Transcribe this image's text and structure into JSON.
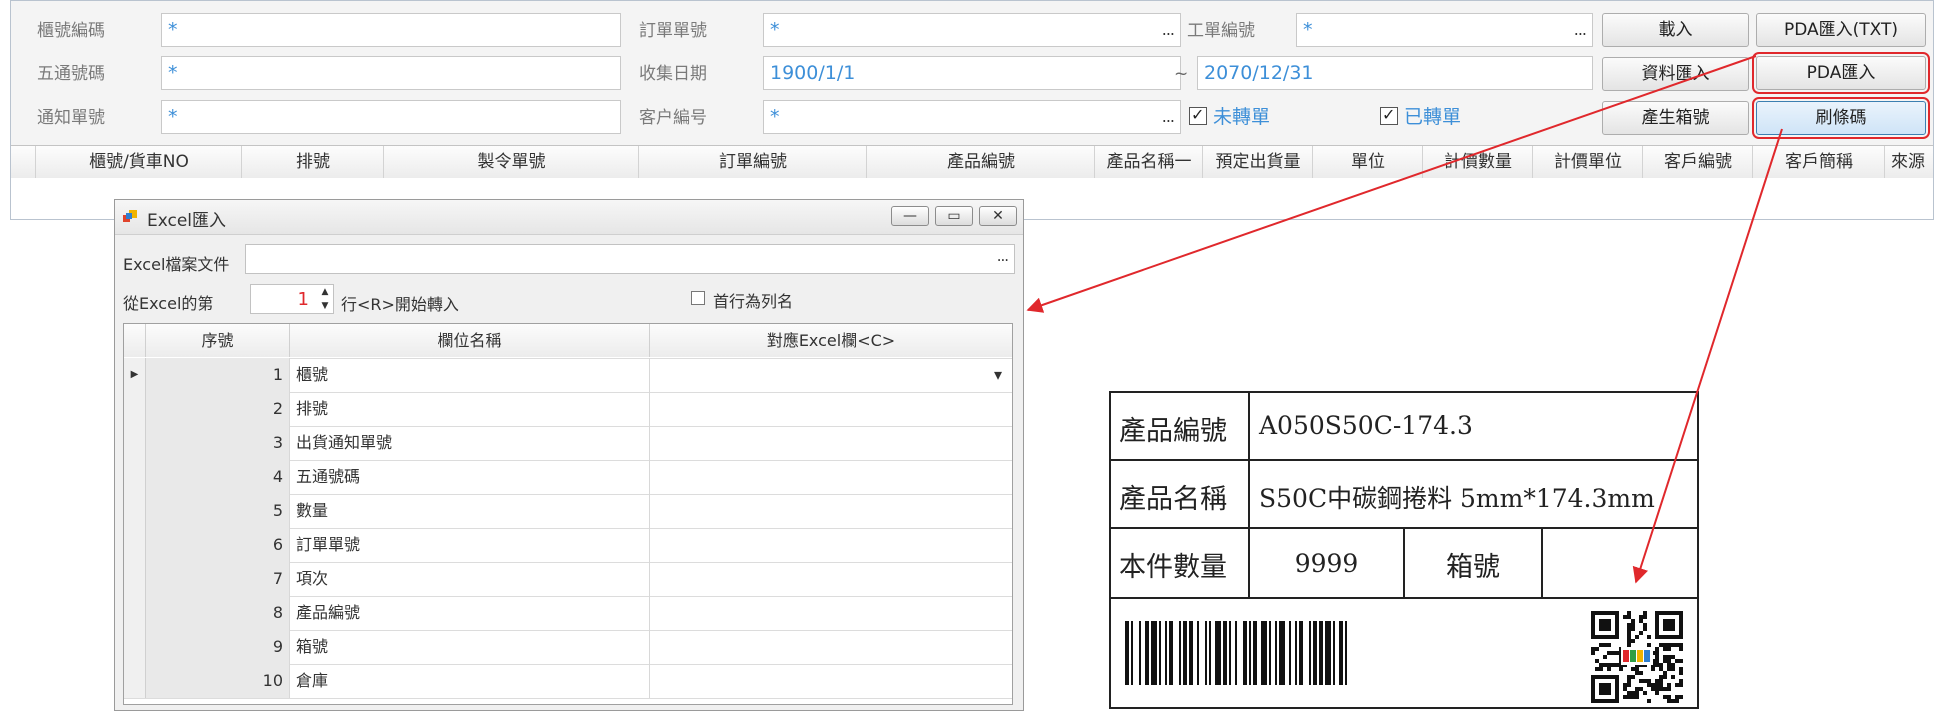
{
  "form": {
    "cabinet_no": {
      "label": "櫃號編碼",
      "value": "*"
    },
    "order_no": {
      "label": "訂單單號",
      "value": "*"
    },
    "work_order": {
      "label": "工單編號",
      "value": "*"
    },
    "five_code": {
      "label": "五通號碼",
      "value": "*"
    },
    "collect_date": {
      "label": "收集日期",
      "from": "1900/1/1",
      "separator": "~",
      "to": "2070/12/31"
    },
    "notice_no": {
      "label": "通知單號",
      "value": "*"
    },
    "customer_no": {
      "label": "客户編号",
      "value": "*"
    },
    "unconverted": {
      "label": "未轉單",
      "checked": true
    },
    "converted": {
      "label": "已轉單",
      "checked": true
    },
    "ellipsis": "..."
  },
  "buttons": {
    "load": "載入",
    "pda_txt": "PDA匯入(TXT)",
    "data_import": "資料匯入",
    "pda_import": "PDA匯入",
    "gen_box": "產生箱號",
    "print_barcode": "刷條碼"
  },
  "grid": {
    "columns": [
      "櫃號/貨車NO",
      "排號",
      "製令單號",
      "訂單編號",
      "產品編號",
      "產品名稱一",
      "預定出貨量",
      "單位",
      "計價數量",
      "計價單位",
      "客戶編號",
      "客戶簡稱",
      "來源"
    ]
  },
  "dialog": {
    "title": "Excel匯入",
    "file_label": "Excel檔案文件",
    "file_value": "",
    "ellipsis": "...",
    "start_prefix": "從Excel的第",
    "start_row": "1",
    "start_suffix": "行<R>開始轉入",
    "header_checkbox": "首行為列名",
    "header_checked": false,
    "table": {
      "headers": [
        "序號",
        "欄位名稱",
        "對應Excel欄<C>"
      ],
      "rows": [
        {
          "seq": "1",
          "name": "櫃號"
        },
        {
          "seq": "2",
          "name": "排號"
        },
        {
          "seq": "3",
          "name": "出貨通知單號"
        },
        {
          "seq": "4",
          "name": "五通號碼"
        },
        {
          "seq": "5",
          "name": "數量"
        },
        {
          "seq": "6",
          "name": "訂單單號"
        },
        {
          "seq": "7",
          "name": "項次"
        },
        {
          "seq": "8",
          "name": "產品編號"
        },
        {
          "seq": "9",
          "name": "箱號"
        },
        {
          "seq": "10",
          "name": "倉庫"
        }
      ]
    }
  },
  "label_card": {
    "product_code_label": "產品編號",
    "product_code": "A050S50C-174.3",
    "product_name_label": "產品名稱",
    "product_name": "S50C中碳鋼捲料 5mm*174.3mm",
    "qty_label": "本件數量",
    "qty": "9999",
    "box_label": "箱號",
    "box_value": ""
  },
  "colors": {
    "accent": "#3d8fd8",
    "highlight": "#e0282c",
    "spin_value": "#e0282c"
  }
}
